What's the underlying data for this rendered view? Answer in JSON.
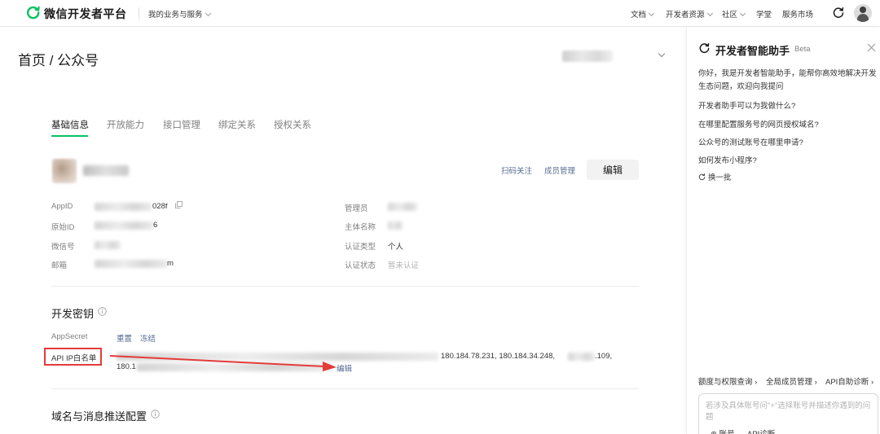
{
  "topbar": {
    "brand": "微信开发者平台",
    "business_menu": "我的业务与服务",
    "nav": [
      {
        "label": "文档",
        "dropdown": true
      },
      {
        "label": "开发者资源",
        "dropdown": true
      },
      {
        "label": "社区",
        "dropdown": true
      },
      {
        "label": "学堂",
        "dropdown": false
      },
      {
        "label": "服务市场",
        "dropdown": false
      }
    ],
    "icons": [
      "refresh-icon",
      "user-avatar"
    ]
  },
  "breadcrumb": "首页 / 公众号",
  "tabs": [
    "基础信息",
    "开放能力",
    "接口管理",
    "绑定关系",
    "授权关系"
  ],
  "active_tab": "基础信息",
  "account": {
    "scan_follow": "扫码关注",
    "member_manage": "成员管理",
    "edit": "编辑"
  },
  "info": {
    "appid_label": "AppID",
    "appid_suffix": "028f",
    "original_id_label": "原始ID",
    "original_id_suffix": "6",
    "wechat_id_label": "微信号",
    "email_label": "邮箱",
    "email_suffix": "m",
    "admin_label": "管理员",
    "subject_label": "主体名称",
    "cert_type_label": "认证类型",
    "cert_type_value": "个人",
    "cert_status_label": "认证状态",
    "cert_status_value": "暂未认证"
  },
  "dev_key": {
    "title": "开发密钥",
    "appsecret_label": "AppSecret",
    "reset": "重置",
    "freeze": "冻结",
    "whitelist_label": "API IP白名单",
    "ip_line1_tail": ".109,",
    "ip_line1_visible": "180.184.78.231, 180.184.34.248,",
    "ip_line2_prefix": "180.1",
    "edit": "编辑"
  },
  "domain_section": {
    "title": "域名与消息推送配置"
  },
  "assistant": {
    "title": "开发者智能助手",
    "badge": "Beta",
    "intro": "你好，我是开发者智能助手，能帮你高效地解决开发生态问题，欢迎向我提问",
    "questions": [
      "开发者助手可以为我做什么?",
      "在哪里配置服务号的网页授权域名?",
      "公众号的测试账号在哪里申请?",
      "如何发布小程序?"
    ],
    "refresh": "换一批",
    "bottom_links": [
      "额度与权限查询",
      "全局成员管理",
      "API自助诊断"
    ],
    "input_placeholder": "若涉及具体账号问\"+\"选择账号并描述你遇到的问题",
    "tags": [
      "账号",
      "API诊断"
    ]
  },
  "colors": {
    "brand_green": "#07c160",
    "link_blue": "#576b95",
    "annotation_red": "#e33c39"
  }
}
